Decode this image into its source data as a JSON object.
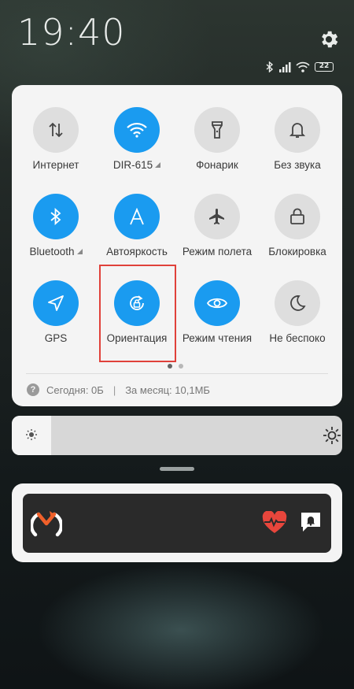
{
  "status": {
    "time": "19:40",
    "battery": "22",
    "icons": [
      "bluetooth-icon",
      "signal-icon",
      "wifi-icon",
      "battery-icon"
    ]
  },
  "quick_settings": {
    "tiles": [
      {
        "label": "Интернет",
        "icon": "mobile-data-icon",
        "active": false
      },
      {
        "label": "DIR-615",
        "icon": "wifi-icon",
        "active": true,
        "expandable": true
      },
      {
        "label": "Фонарик",
        "icon": "flashlight-icon",
        "active": false
      },
      {
        "label": "Без звука",
        "icon": "bell-icon",
        "active": false
      },
      {
        "label": "Bluetooth",
        "icon": "bluetooth-icon",
        "active": true,
        "expandable": true
      },
      {
        "label": "Автояркость",
        "icon": "auto-brightness-icon",
        "active": true
      },
      {
        "label": "Режим полета",
        "icon": "airplane-icon",
        "active": false
      },
      {
        "label": "Блокировка",
        "icon": "lock-icon",
        "active": false
      },
      {
        "label": "GPS",
        "icon": "location-icon",
        "active": true
      },
      {
        "label": "Ориентация",
        "icon": "rotation-lock-icon",
        "active": true,
        "highlighted": true
      },
      {
        "label": "Режим чтения",
        "icon": "eye-icon",
        "active": true
      },
      {
        "label": "Не беспоко",
        "icon": "moon-icon",
        "active": false
      }
    ],
    "page_count": 2,
    "current_page": 1,
    "data_usage": {
      "today": "Сегодня: 0Б",
      "separator": "|",
      "month": "За месяц: 10,1МБ"
    }
  },
  "brightness": {
    "level": 0.12
  },
  "notification": {
    "app_icon": "mi-fit-logo-icon",
    "actions": [
      "heart-rate-icon",
      "notification-bell-icon"
    ]
  },
  "colors": {
    "accent": "#1a9bf0",
    "tile_off": "#dedede",
    "highlight": "#e0413a",
    "panel": "#f4f4f4"
  }
}
